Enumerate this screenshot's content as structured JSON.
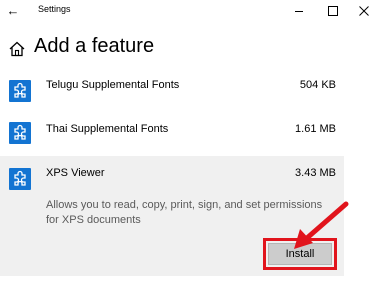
{
  "window": {
    "title": "Settings",
    "back_glyph": "←",
    "minimize_glyph": "–",
    "maximize_glyph": "☐",
    "close_glyph": "✕"
  },
  "page": {
    "title": "Add a feature",
    "icon": "home-icon"
  },
  "features": [
    {
      "name": "Telugu Supplemental Fonts",
      "size": "504 KB",
      "icon": "puzzle-icon"
    },
    {
      "name": "Thai Supplemental Fonts",
      "size": "1.61 MB",
      "icon": "puzzle-icon"
    },
    {
      "name": "XPS Viewer",
      "size": "3.43 MB",
      "icon": "puzzle-icon",
      "description": "Allows you to read, copy, print, sign, and set permissions for XPS documents",
      "selected": true
    }
  ],
  "actions": {
    "install_label": "Install"
  },
  "colors": {
    "accent": "#1374d2",
    "highlight": "#e1141c",
    "selected_bg": "#f0f0f0",
    "button_bg": "#cccccc"
  }
}
